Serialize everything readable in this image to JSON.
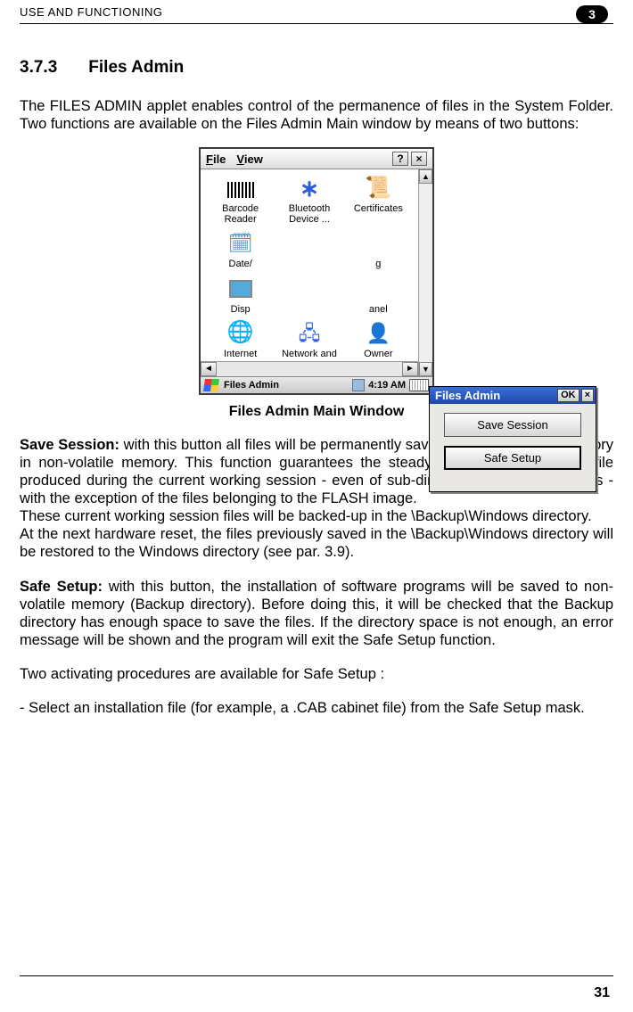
{
  "header": {
    "running_title": "USE AND FUNCTIONING",
    "chapter_badge": "3"
  },
  "heading": {
    "number": "3.7.3",
    "title": "Files Admin"
  },
  "intro": "The FILES ADMIN applet enables control of the permanence of files in the System Folder. Two functions are available on the Files Admin Main window by means of two buttons:",
  "figure": {
    "caption": "Files Admin Main Window",
    "pda": {
      "menu_file": "File",
      "menu_view": "View",
      "help_btn": "?",
      "close_btn": "×",
      "items": {
        "barcode": "Barcode Reader",
        "bluetooth": "Bluetooth Device ...",
        "certs": "Certificates",
        "date": "Date/",
        "dialing": "g",
        "display": "Disp",
        "panel_suffix": "anel",
        "internet": "Internet",
        "network": "Network and",
        "owner": "Owner"
      },
      "dialog": {
        "title": "Files Admin",
        "ok": "OK",
        "close": "×",
        "save_session": "Save Session",
        "safe_setup": "Safe Setup"
      },
      "taskbar": {
        "title": "Files Admin",
        "time": "4:19 AM"
      },
      "scroll": {
        "left": "◄",
        "right": "►",
        "up": "▲",
        "down": "▼"
      }
    }
  },
  "save_session": {
    "label": "Save Session:",
    "p1": " with this button all files will be permanently saved in the \\Windows directory in non-volatile memory. This function guarantees the steady maintenance of every file produced during the current working session - even of sub-directories and relevant files - with the exception of the files belonging to the FLASH image.",
    "p2": "These current working session files will be backed-up in the \\Backup\\Windows directory.",
    "p3": "At the next hardware reset, the files previously saved in the \\Backup\\Windows directory will be restored to the Windows directory (see par. 3.9)."
  },
  "safe_setup": {
    "label": "Safe Setup:",
    "p1": " with this button, the installation of software programs will be saved to non-volatile memory (Backup directory). Before doing this, it will be checked that the Backup directory has enough space to save the files. If the directory space is not enough, an error message will be shown and the program will exit the Safe Setup function."
  },
  "procedures_intro": "Two activating procedures are available for Safe Setup :",
  "procedure_1": "- Select an installation file (for example, a .CAB cabinet file) from the Safe Setup mask.",
  "page_number": "31"
}
